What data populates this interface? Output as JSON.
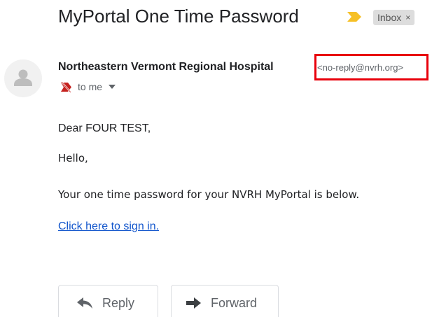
{
  "email": {
    "subject": "MyPortal One Time Password",
    "label": "Inbox",
    "label_remove": "×",
    "sender_name": "Northeastern Vermont Regional Hospital",
    "sender_email": "<no-reply@nvrh.org>",
    "recipient": "to me"
  },
  "body": {
    "greeting": "Dear FOUR TEST,",
    "hello": "Hello,",
    "otp_text": "Your one time password for your NVRH MyPortal is below.",
    "link_text": "Click here to sign in."
  },
  "actions": {
    "reply_label": "Reply",
    "forward_label": "Forward"
  },
  "colors": {
    "importance": "#f6c026",
    "highlight": "#e8000b",
    "link": "#1155cc",
    "not_important": "#c5221f"
  },
  "icons": {
    "importance": "importance-marker-icon",
    "avatar": "person-avatar-icon",
    "not_important": "not-important-icon",
    "recipient_dropdown": "dropdown-arrow-icon",
    "reply": "reply-arrow-icon",
    "forward": "forward-arrow-icon"
  }
}
